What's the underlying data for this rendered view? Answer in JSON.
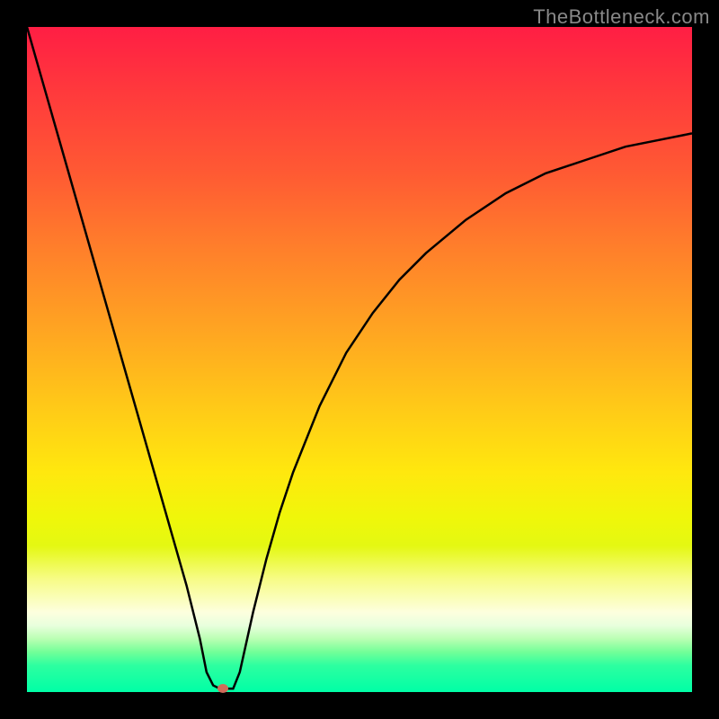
{
  "watermark": "TheBottleneck.com",
  "chart_data": {
    "type": "line",
    "title": "",
    "xlabel": "",
    "ylabel": "",
    "xlim": [
      0,
      100
    ],
    "ylim": [
      0,
      100
    ],
    "x": [
      0,
      2,
      4,
      6,
      8,
      10,
      12,
      14,
      16,
      18,
      20,
      22,
      24,
      26,
      27,
      28,
      29,
      30,
      31,
      32,
      34,
      36,
      38,
      40,
      44,
      48,
      52,
      56,
      60,
      66,
      72,
      78,
      84,
      90,
      95,
      100
    ],
    "values": [
      100,
      93,
      86,
      79,
      72,
      65,
      58,
      51,
      44,
      37,
      30,
      23,
      16,
      8,
      3,
      1,
      0.5,
      0.5,
      0.5,
      3,
      12,
      20,
      27,
      33,
      43,
      51,
      57,
      62,
      66,
      71,
      75,
      78,
      80,
      82,
      83,
      84
    ],
    "min_marker": {
      "x": 29.5,
      "y": 0.5,
      "color": "#d06b5a"
    },
    "background_gradient": [
      "#ff1e44",
      "#ff3a3c",
      "#ff5a33",
      "#ff7e2b",
      "#ffa322",
      "#ffc918",
      "#ffe80e",
      "#eff70a",
      "#e4f812",
      "#f7fc86",
      "#fdffde",
      "#e8ffdd",
      "#baffb3",
      "#72ff98",
      "#2dffa0",
      "#00ffa6"
    ]
  }
}
